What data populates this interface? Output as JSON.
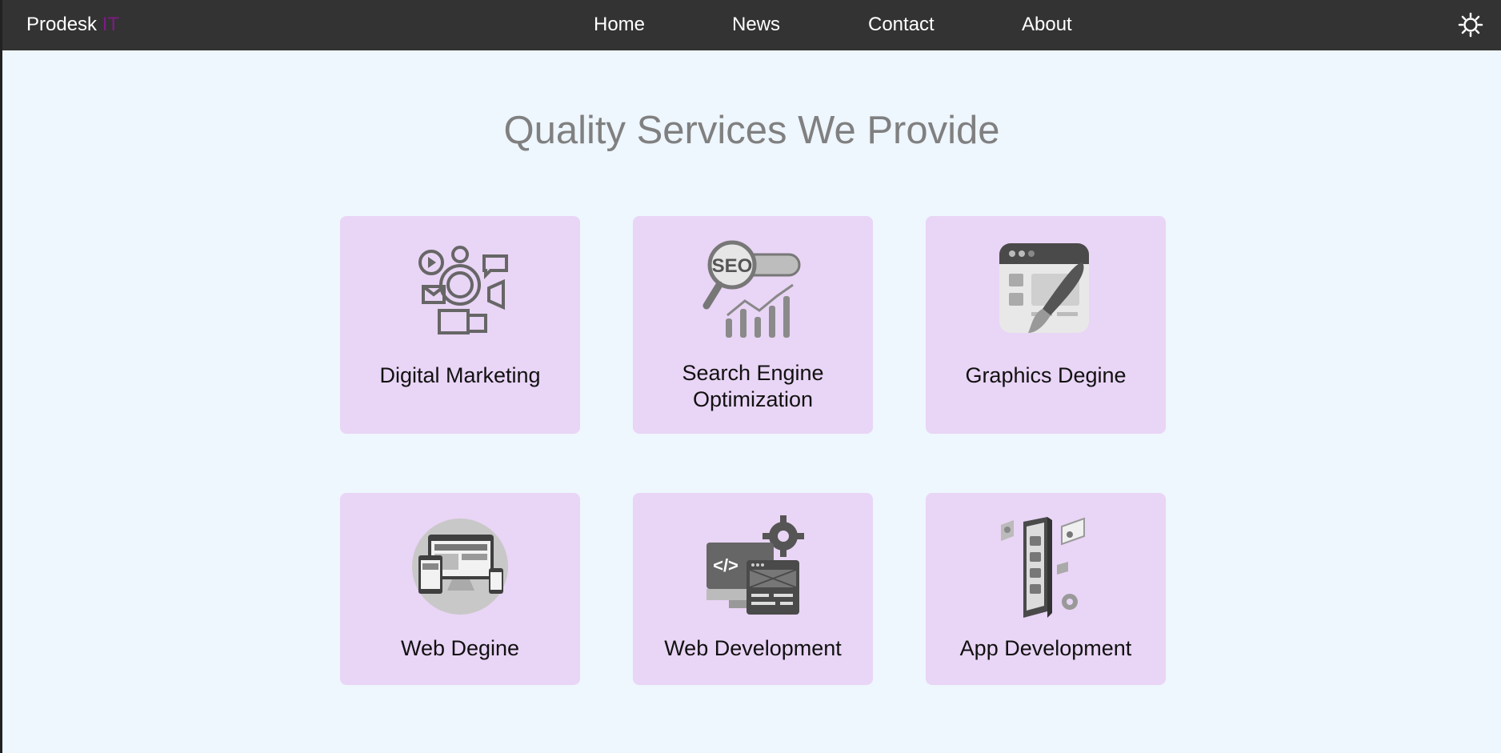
{
  "navbar": {
    "brand_name": "Prodesk",
    "brand_accent": "IT",
    "links": [
      "Home",
      "News",
      "Contact",
      "About"
    ],
    "theme_icon": "sun-icon"
  },
  "main": {
    "title": "Quality Services We Provide",
    "services": [
      {
        "label": "Digital Marketing",
        "icon": "digital-marketing-icon"
      },
      {
        "label": "Search Engine Optimization",
        "icon": "seo-icon"
      },
      {
        "label": "Graphics Degine",
        "icon": "graphics-design-icon"
      },
      {
        "label": "Web Degine",
        "icon": "web-design-icon"
      },
      {
        "label": "Web Development",
        "icon": "web-development-icon"
      },
      {
        "label": "App Development",
        "icon": "app-development-icon"
      }
    ]
  },
  "colors": {
    "navbar_bg": "#333333",
    "page_bg": "#eef6fe",
    "card_bg": "#e9d5f5",
    "brand_accent": "#7d1c84",
    "title": "#808080"
  }
}
